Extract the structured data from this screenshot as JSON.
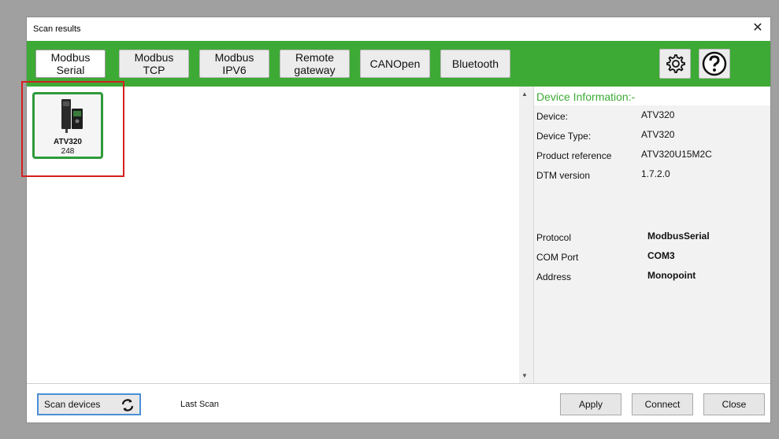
{
  "window": {
    "title": "Scan results",
    "close_glyph": "✕"
  },
  "toolbar": {
    "protocols": [
      {
        "label": "Modbus\nSerial",
        "active": true
      },
      {
        "label": "Modbus\nTCP",
        "active": false
      },
      {
        "label": "Modbus\nIPV6",
        "active": false
      },
      {
        "label": "Remote\ngateway",
        "active": false
      },
      {
        "label": "CANOpen",
        "active": false
      },
      {
        "label": "Bluetooth",
        "active": false
      }
    ],
    "settings_icon": "gear-icon",
    "help_icon": "help-icon"
  },
  "devices": [
    {
      "name": "ATV320",
      "address": "248"
    }
  ],
  "info": {
    "header": "Device Information:-",
    "rows": [
      {
        "label": "Device:",
        "value": "ATV320"
      },
      {
        "label": "Device Type:",
        "value": "ATV320"
      },
      {
        "label": "Product reference",
        "value": "ATV320U15M2C"
      },
      {
        "label": "DTM version",
        "value": "1.7.2.0"
      }
    ],
    "comm_rows": [
      {
        "label": "Protocol",
        "value": "ModbusSerial"
      },
      {
        "label": "COM Port",
        "value": "COM3"
      },
      {
        "label": "Address",
        "value": "Monopoint"
      }
    ]
  },
  "bottom": {
    "scan_label": "Scan devices",
    "last_scan_label": "Last Scan",
    "apply_label": "Apply",
    "connect_label": "Connect",
    "close_label": "Close"
  },
  "colors": {
    "accent": "#3daa35",
    "highlight": "#d42020",
    "tile_border": "#2e9a3a"
  }
}
